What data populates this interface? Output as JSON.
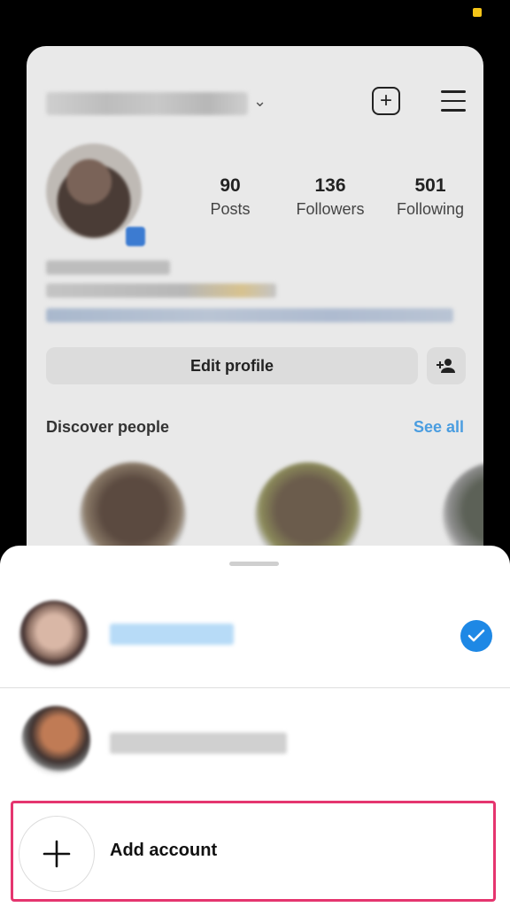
{
  "profile": {
    "stats": [
      {
        "value": "90",
        "label": "Posts"
      },
      {
        "value": "136",
        "label": "Followers"
      },
      {
        "value": "501",
        "label": "Following"
      }
    ],
    "edit_profile_label": "Edit profile",
    "discover_title": "Discover people",
    "see_all_label": "See all"
  },
  "sheet": {
    "add_account_label": "Add account"
  },
  "colors": {
    "accent_blue": "#1e88e5",
    "highlight_pink": "#e5356f",
    "status_dot": "#f5c518"
  }
}
